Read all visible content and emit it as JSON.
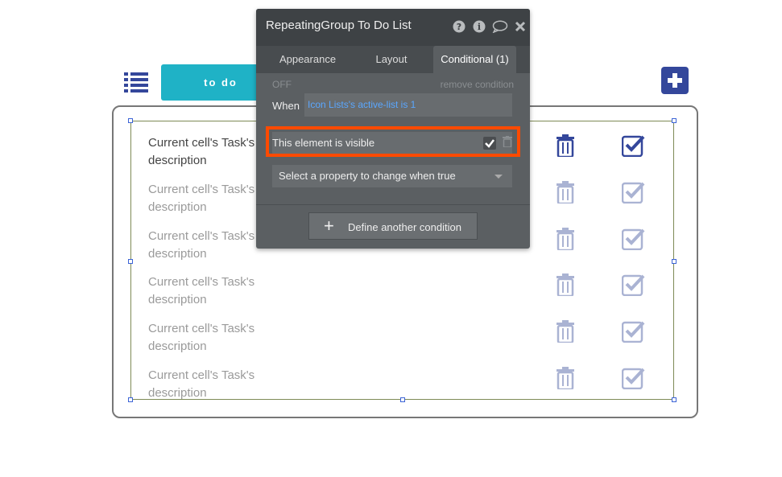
{
  "toolbar": {
    "todo_tab_label": "to do"
  },
  "panel": {
    "title": "RepeatingGroup To Do List",
    "tabs": [
      "Appearance",
      "Layout",
      "Conditional (1)"
    ],
    "off_label": "OFF",
    "remove_condition": "remove condition",
    "when_label": "When",
    "when_value": "Icon Lists's active-list is 1",
    "visible_label": "This element is visible",
    "select_property": "Select a property to change when true",
    "define_button": "Define another condition"
  },
  "list": {
    "rows": [
      {
        "line1": "Current cell's Task's",
        "line2": "description"
      },
      {
        "line1": "Current cell's Task's",
        "line2": "description"
      },
      {
        "line1": "Current cell's Task's",
        "line2": "description"
      },
      {
        "line1": "Current cell's Task's",
        "line2": "description"
      },
      {
        "line1": "Current cell's Task's",
        "line2": "description"
      },
      {
        "line1": "Current cell's Task's",
        "line2": "description"
      }
    ]
  },
  "colors": {
    "accent_teal": "#1fb2c6",
    "brand_blue": "#34479b",
    "highlight_orange": "#ff4a00",
    "link_blue": "#5aa7ff"
  },
  "icons": [
    "list-icon",
    "plus-icon",
    "trash-icon",
    "checkbox-icon",
    "help-icon",
    "info-icon",
    "comment-icon",
    "close-icon"
  ]
}
